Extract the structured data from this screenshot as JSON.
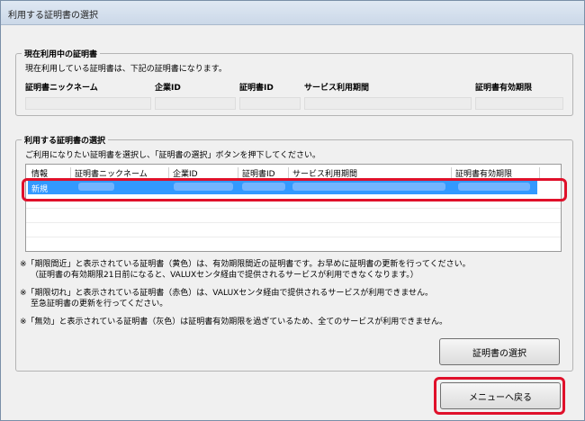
{
  "window": {
    "title": "利用する証明書の選択"
  },
  "current_group": {
    "title": "現在利用中の証明書",
    "description": "現在利用している証明書は、下記の証明書になります。",
    "headers": [
      "証明書ニックネーム",
      "企業ID",
      "証明書ID",
      "サービス利用期間",
      "証明書有効期限"
    ]
  },
  "select_group": {
    "title": "利用する証明書の選択",
    "description": "ご利用になりたい証明書を選択し、「証明書の選択」ボタンを押下してください。",
    "columns": [
      "情報",
      "証明書ニックネーム",
      "企業ID",
      "証明書ID",
      "サービス利用期間",
      "証明書有効期限"
    ],
    "rows": [
      {
        "info": "新規",
        "selected": true
      }
    ]
  },
  "notes": {
    "n1_l1": "※「期限間近」と表示されている証明書（黄色）は、有効期限間近の証明書です。お早めに証明書の更新を行ってください。",
    "n1_l2": "（証明書の有効期限21日前になると、VALUXセンタ経由で提供されるサービスが利用できなくなります。）",
    "n2_l1": "※「期限切れ」と表示されている証明書（赤色）は、VALUXセンタ経由で提供されるサービスが利用できません。",
    "n2_l2": "至急証明書の更新を行ってください。",
    "n3_l1": "※「無効」と表示されている証明書（灰色）は証明書有効期限を過ぎているため、全てのサービスが利用できません。"
  },
  "buttons": {
    "select_cert": "証明書の選択",
    "back_to_menu": "メニューへ戻る"
  },
  "colors": {
    "selection": "#3399ff",
    "highlight": "#e0102a"
  }
}
